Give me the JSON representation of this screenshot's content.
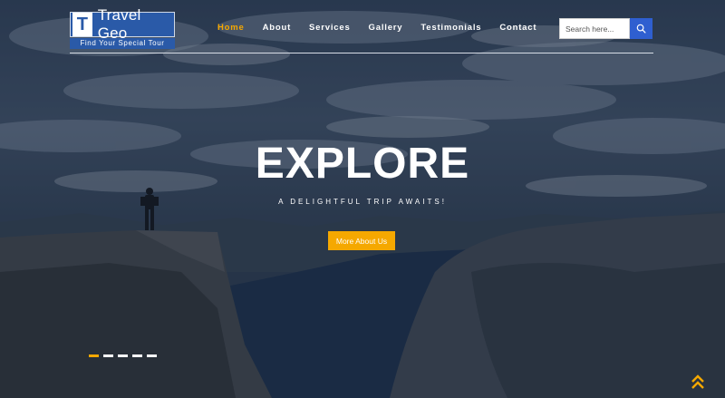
{
  "brand": {
    "letter": "T",
    "name": "Travel Geo",
    "tagline": "Find Your Special Tour"
  },
  "nav": {
    "items": [
      {
        "label": "Home",
        "active": true
      },
      {
        "label": "About",
        "active": false
      },
      {
        "label": "Services",
        "active": false
      },
      {
        "label": "Gallery",
        "active": false
      },
      {
        "label": "Testimonials",
        "active": false
      },
      {
        "label": "Contact",
        "active": false
      }
    ]
  },
  "search": {
    "placeholder": "Search here...",
    "icon": "search-icon"
  },
  "hero": {
    "title": "EXPLORE",
    "subtitle": "A DELIGHTFUL TRIP AWAITS!",
    "button_label": "More About Us"
  },
  "carousel": {
    "slide_count": 5,
    "active_index": 0
  },
  "scroll_top": {
    "icon": "double-chevron-up-icon"
  },
  "colors": {
    "accent": "#f5a800",
    "brand_blue": "#2a5aa8",
    "search_button": "#2f5fd0"
  }
}
